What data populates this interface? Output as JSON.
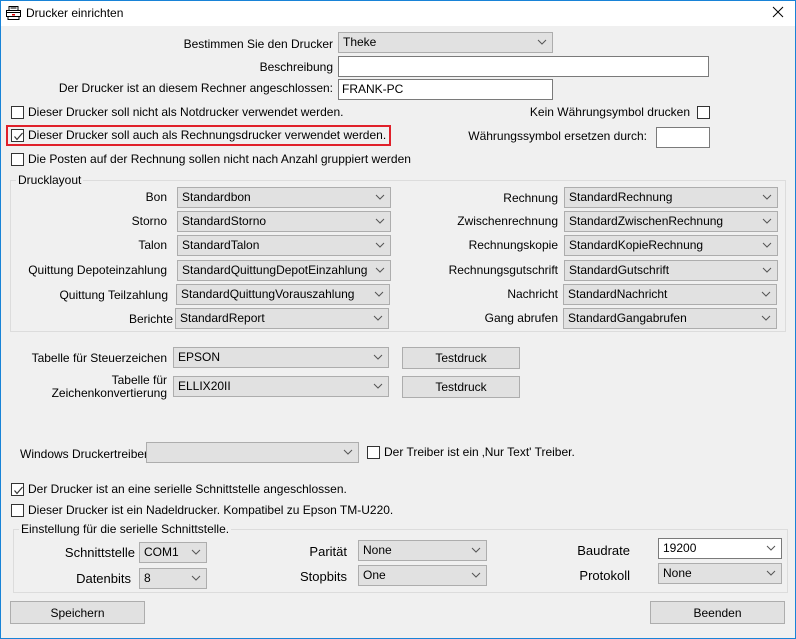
{
  "window": {
    "title": "Drucker einrichten",
    "icon": "printer-icon",
    "close_icon": "close-icon"
  },
  "printer": {
    "select_label": "Bestimmen Sie den Drucker",
    "select_value": "Theke",
    "description_label": "Beschreibung",
    "description_value": "",
    "computer_label": "Der Drucker ist an diesem Rechner angeschlossen:",
    "computer_value": "FRANK-PC"
  },
  "options": {
    "not_emergency_label": "Dieser Drucker soll nicht als Notdrucker verwendet werden.",
    "not_emergency_checked": false,
    "invoice_printer_label": "Dieser Drucker soll auch als Rechnungsdrucker verwendet werden.",
    "invoice_printer_checked": true,
    "no_grouping_label": "Die Posten auf der Rechnung sollen nicht nach Anzahl gruppiert werden",
    "no_grouping_checked": false,
    "no_currency_label": "Kein Währungsymbol drucken",
    "no_currency_checked": false,
    "replace_currency_label": "Währungssymbol ersetzen durch:",
    "replace_currency_value": ""
  },
  "layout": {
    "group_title": "Drucklayout",
    "left": [
      {
        "label": "Bon",
        "value": "Standardbon"
      },
      {
        "label": "Storno",
        "value": "StandardStorno"
      },
      {
        "label": "Talon",
        "value": "StandardTalon"
      },
      {
        "label": "Quittung Depoteinzahlung",
        "value": "StandardQuittungDepotEinzahlung"
      },
      {
        "label": "Quittung Teilzahlung",
        "value": "StandardQuittungVorauszahlung"
      },
      {
        "label": "Berichte",
        "value": "StandardReport"
      }
    ],
    "right": [
      {
        "label": "Rechnung",
        "value": "StandardRechnung"
      },
      {
        "label": "Zwischenrechnung",
        "value": "StandardZwischenRechnung"
      },
      {
        "label": "Rechnungskopie",
        "value": "StandardKopieRechnung"
      },
      {
        "label": "Rechnungsgutschrift",
        "value": "StandardGutschrift"
      },
      {
        "label": "Nachricht",
        "value": "StandardNachricht"
      },
      {
        "label": "Gang abrufen",
        "value": "StandardGangabrufen"
      }
    ]
  },
  "tables": {
    "control_label": "Tabelle für Steuerzeichen",
    "control_value": "EPSON",
    "conversion_label_line1": "Tabelle für",
    "conversion_label_line2": "Zeichenkonvertierung",
    "conversion_value": "ELLIX20II",
    "test_button": "Testdruck"
  },
  "driver": {
    "label": "Windows Druckertreiber",
    "value": "",
    "text_only_label": "Der Treiber ist ein ‚Nur Text' Treiber.",
    "text_only_checked": false
  },
  "serial": {
    "serial_connected_label": "Der Drucker ist an eine serielle Schnittstelle angeschlossen.",
    "serial_connected_checked": true,
    "dot_matrix_label": "Dieser Drucker ist ein Nadeldrucker. Kompatibel zu Epson TM-U220.",
    "dot_matrix_checked": false,
    "group_title": "Einstellung für die serielle Schnittstelle.",
    "port_label": "Schnittstelle",
    "port_value": "COM1",
    "databits_label": "Datenbits",
    "databits_value": "8",
    "parity_label": "Parität",
    "parity_value": "None",
    "stopbits_label": "Stopbits",
    "stopbits_value": "One",
    "baud_label": "Baudrate",
    "baud_value": "19200",
    "protocol_label": "Protokoll",
    "protocol_value": "None"
  },
  "footer": {
    "save_button": "Speichern",
    "exit_button": "Beenden"
  },
  "colors": {
    "window_border": "#1883d7",
    "highlight": "#e0202a"
  }
}
